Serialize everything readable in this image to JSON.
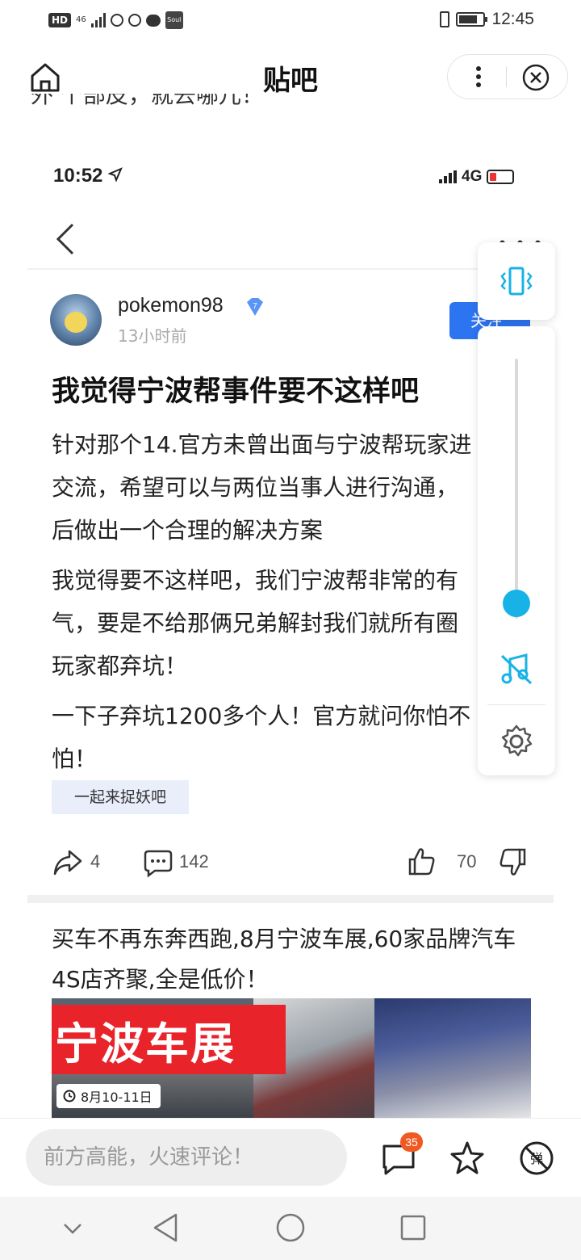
{
  "status_bar": {
    "hd": "HD",
    "network": "46",
    "app_badge": "Soul",
    "time": "12:45"
  },
  "header": {
    "title": "贴吧",
    "truncated_text": "外 个部皮，就去哪儿！"
  },
  "inner_screenshot": {
    "status": {
      "time": "10:52",
      "network": "4G"
    },
    "post": {
      "username": "pokemon98",
      "verified_level": "7",
      "time_ago": "13小时前",
      "follow_label": "关注",
      "title": "我觉得宁波帮事件要不这样吧",
      "paragraphs": [
        [
          "针对那个14.官方未曾出面与宁波帮玩家进",
          "交流，希望可以与两位当事人进行沟通，",
          "后做出一个合理的解决方案"
        ],
        [
          "我觉得要不这样吧，我们宁波帮非常的有",
          "气，要是不给那俩兄弟解封我们就所有圈",
          "玩家都弃坑！"
        ],
        [
          "一下子弃坑1200多个人！官方就问你怕不",
          "怕！"
        ]
      ],
      "tag": "一起来捉妖吧",
      "share_count": "4",
      "comment_count": "142",
      "like_count": "70"
    },
    "ad": {
      "text": "买车不再东奔西跑,8月宁波车展,60家品牌汽车4S店齐聚,全是低价！",
      "banner_title": "宁波车展",
      "banner_date": "8月10-11日"
    }
  },
  "floating_panel": {
    "volume_level": 0.06
  },
  "bottom_bar": {
    "comment_placeholder": "前方高能，火速评论！",
    "comment_badge": "35"
  },
  "colors": {
    "accent": "#17b2e6",
    "follow_blue": "#2d74f0",
    "badge_orange": "#f05a22",
    "banner_red": "#e8242a"
  }
}
